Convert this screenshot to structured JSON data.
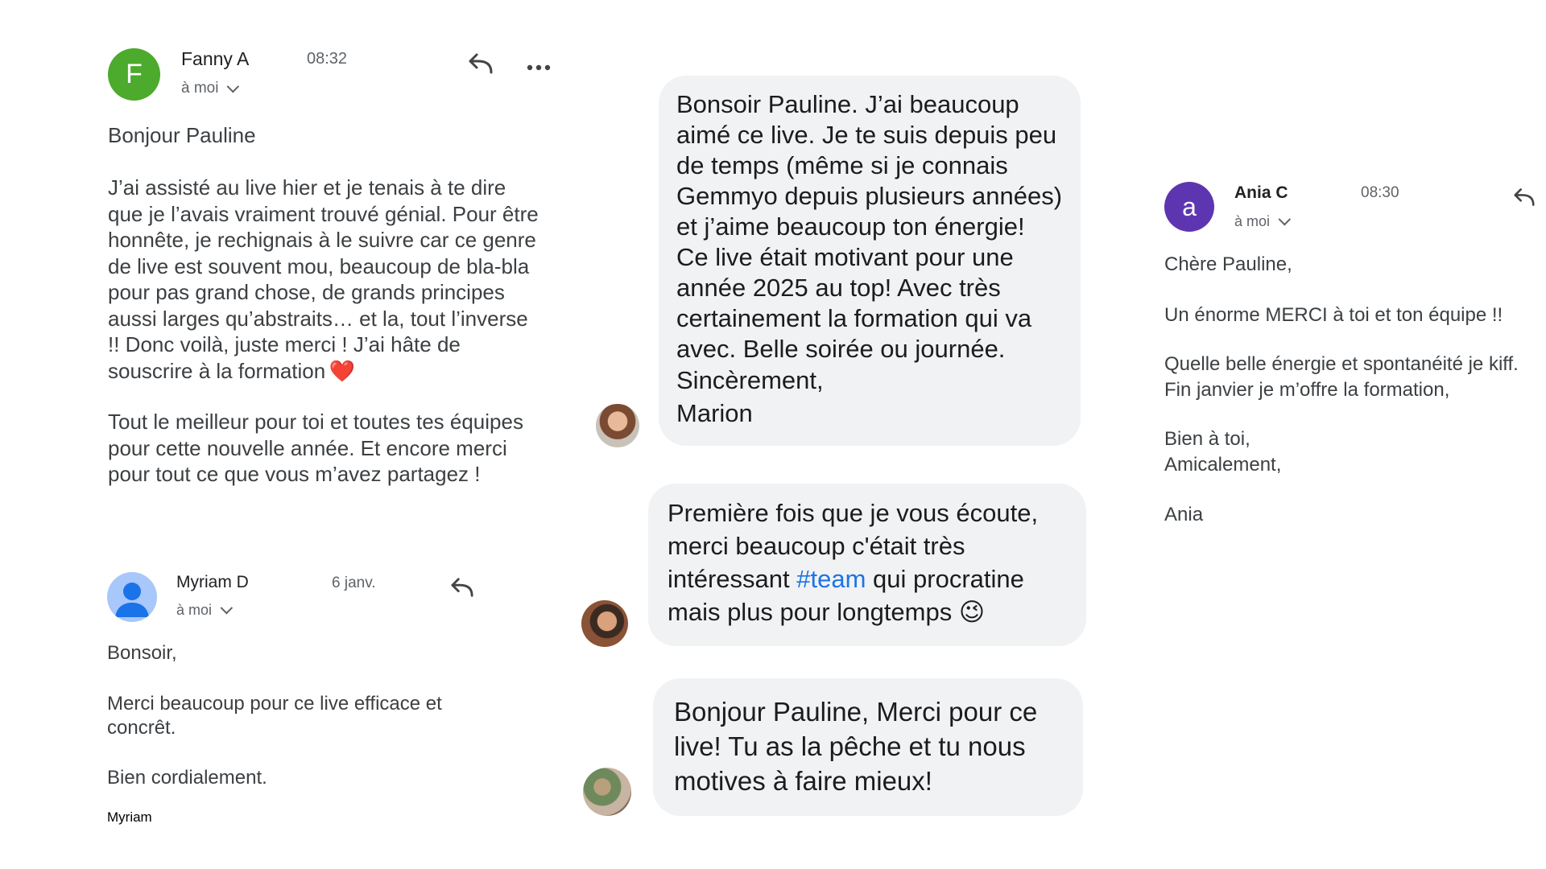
{
  "emails": {
    "fanny": {
      "avatar_letter": "F",
      "avatar_color": "#4caa2c",
      "sender": "Fanny A",
      "time": "08:32",
      "recipient": "à moi",
      "icons": [
        "reply-icon",
        "more-horizontal-icon"
      ],
      "greeting": "Bonjour Pauline",
      "body1": "J’ai assisté au live hier et je tenais à te dire\nque je l’avais vraiment trouvé génial. Pour être\nhonnête, je rechignais à le suivre car ce genre\nde live est souvent mou, beaucoup de bla-bla\npour pas grand chose, de grands principes\naussi larges qu’abstraits… et la, tout l’inverse\n!! Donc voilà, juste merci ! J’ai hâte de\nsouscrire à la formation",
      "heart": "❤️",
      "body2": "Tout le meilleur pour toi et toutes tes équipes\npour cette nouvelle année. Et encore merci\npour tout ce que vous m’avez partagez !"
    },
    "myriam": {
      "avatar_color": "#a8c7fa",
      "avatar_figure_color": "#1a73e8",
      "sender": "Myriam D",
      "time": "6 janv.",
      "recipient": "à moi",
      "greeting": "Bonsoir,",
      "body": "Merci beaucoup pour ce live efficace et\nconcrêt.",
      "closing": "Bien cordialement.",
      "signature": "Myriam"
    },
    "ania": {
      "avatar_letter": "a",
      "avatar_color": "#5e35b1",
      "sender": "Ania C",
      "time": "08:30",
      "recipient": "à moi",
      "greeting": "Chère Pauline,",
      "line1": "Un énorme MERCI à toi et ton équipe !!",
      "line2": "Quelle belle énergie et spontanéité je kiff.\nFin janvier je m’offre la formation,",
      "line3": "Bien à toi,\nAmicalement,",
      "signature": "Ania"
    }
  },
  "comments": [
    {
      "text": "Bonsoir Pauline. J’ai beaucoup\naimé ce live. Je te suis depuis peu\nde temps (même si je connais\nGemmyo depuis plusieurs années)\net j’aime beaucoup ton énergie!\nCe live était motivant pour une\nannée 2025 au top! Avec très\ncertainement la formation qui va\navec. Belle soirée ou journée.",
      "closing": "Sincèrement,\nMarion"
    },
    {
      "text_before": "Première fois que je vous écoute,\nmerci beaucoup c'était très\nintéressant ",
      "hashtag": "#team",
      "text_after": " qui procratine\nmais plus pour longtemps",
      "emoji": "😉"
    },
    {
      "text": "Bonjour Pauline, Merci pour ce\nlive! Tu as la pêche et tu nous\nmotives à faire mieux!"
    }
  ]
}
